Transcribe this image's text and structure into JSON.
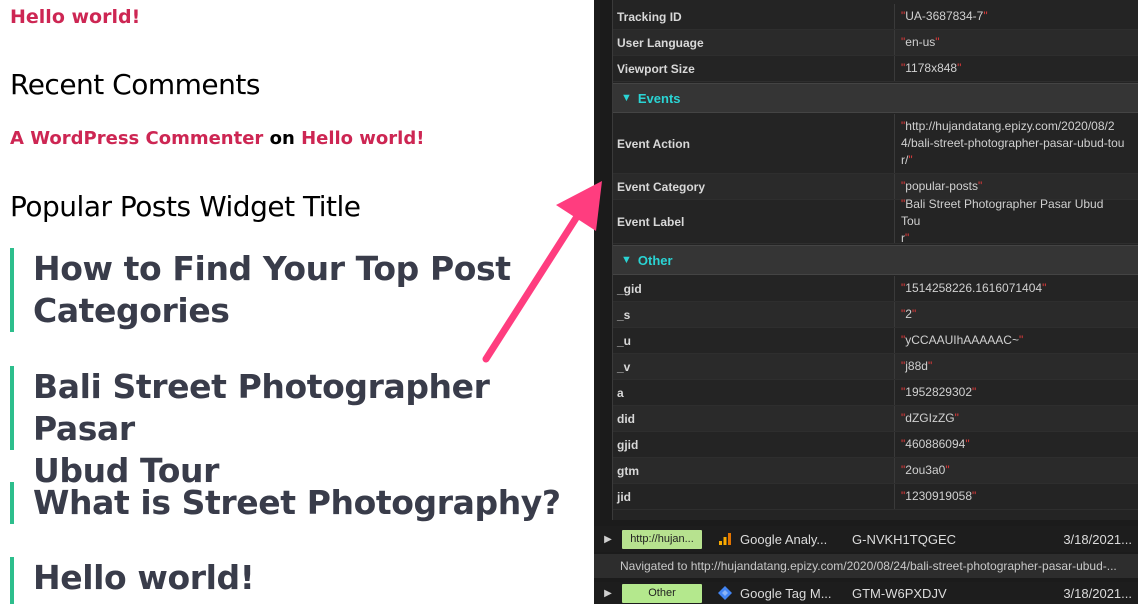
{
  "wp": {
    "top_link": "Hello world!",
    "recent_comments_title": "Recent Comments",
    "comment": {
      "author": "A WordPress Commenter",
      "on": "on",
      "post": "Hello world!"
    },
    "popular_posts_title": "Popular Posts Widget Title",
    "posts": [
      {
        "line1": "How to Find Your Top Post",
        "line2": "Categories"
      },
      {
        "line1": "Bali Street Photographer Pasar",
        "line2": "Ubud Tour"
      },
      {
        "line1": "What is Street Photography?"
      },
      {
        "line1": "Hello world!"
      }
    ]
  },
  "debugger": {
    "general_rows": [
      {
        "key": "Tracking ID",
        "value": "UA-3687834-7"
      },
      {
        "key": "User Language",
        "value": "en-us"
      },
      {
        "key": "Viewport Size",
        "value": "1178x848"
      }
    ],
    "events_label": "Events",
    "event_rows": [
      {
        "key": "Event Action",
        "value1": "http://hujandatang.epizy.com/2020/08/2",
        "value2": "4/bali-street-photographer-pasar-ubud-tou",
        "value3": "r/"
      },
      {
        "key": "Event Category",
        "value": "popular-posts"
      },
      {
        "key": "Event Label",
        "value1": "Bali Street Photographer Pasar Ubud Tou",
        "value2": "r"
      }
    ],
    "other_label": "Other",
    "other_rows": [
      {
        "key": "_gid",
        "value": "1514258226.1616071404"
      },
      {
        "key": "_s",
        "value": "2"
      },
      {
        "key": "_u",
        "value": "yCCAAUIhAAAAAC~"
      },
      {
        "key": "_v",
        "value": "j88d"
      },
      {
        "key": "a",
        "value": "1952829302"
      },
      {
        "key": "did",
        "value": "dZGIzZG"
      },
      {
        "key": "gjid",
        "value": "460886094"
      },
      {
        "key": "gtm",
        "value": "2ou3a0"
      },
      {
        "key": "jid",
        "value": "1230919058"
      }
    ],
    "requests": [
      {
        "tag": "http://hujan...",
        "name": "Google Analy...",
        "id": "G-NVKH1TQGEC",
        "date": "3/18/2021..."
      },
      {
        "tag": "Other",
        "name": "Google Tag M...",
        "id": "GTM-W6PXDJV",
        "date": "3/18/2021..."
      }
    ],
    "navigated_note": "Navigated to http://hujandatang.epizy.com/2020/08/24/bali-street-photographer-pasar-ubud-..."
  },
  "colors": {
    "accent": "#cd2653",
    "post_border": "#2dbe8c",
    "section_text": "#2ad4d4",
    "quote": "#e03a3a",
    "arrow": "#ff3d7f"
  },
  "icons": [
    "analytics-bars-icon",
    "tag-manager-diamond-icon",
    "expand-triangle-icon",
    "pointer-arrow"
  ]
}
